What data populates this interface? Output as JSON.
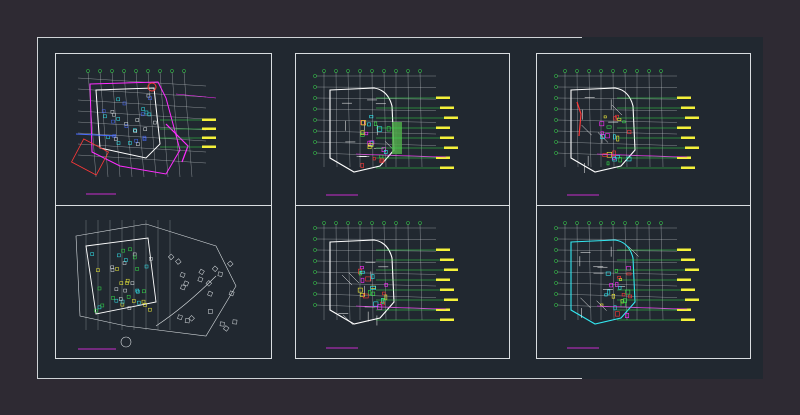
{
  "app": {
    "background_color": "#2e2a33",
    "sheet_color": "#212830",
    "frame_color": "#d9dde0"
  },
  "viewports": [
    {
      "id": "vp1",
      "caption": "",
      "variant": "ground"
    },
    {
      "id": "vp2",
      "caption": "",
      "variant": "upper-green"
    },
    {
      "id": "vp3",
      "caption": "",
      "variant": "upper-red"
    },
    {
      "id": "vp4",
      "caption": "",
      "variant": "site"
    },
    {
      "id": "vp5",
      "caption": "",
      "variant": "upper-plain"
    },
    {
      "id": "vp6",
      "caption": "",
      "variant": "upper-cyan"
    }
  ],
  "colors": {
    "grid": "#d8dde0",
    "wall": "#ffffff",
    "green": "#35e04a",
    "yellow": "#f5f23a",
    "cyan": "#33e7f0",
    "red": "#ff3838",
    "magenta": "#ff2cff",
    "blue": "#4a6cff"
  }
}
